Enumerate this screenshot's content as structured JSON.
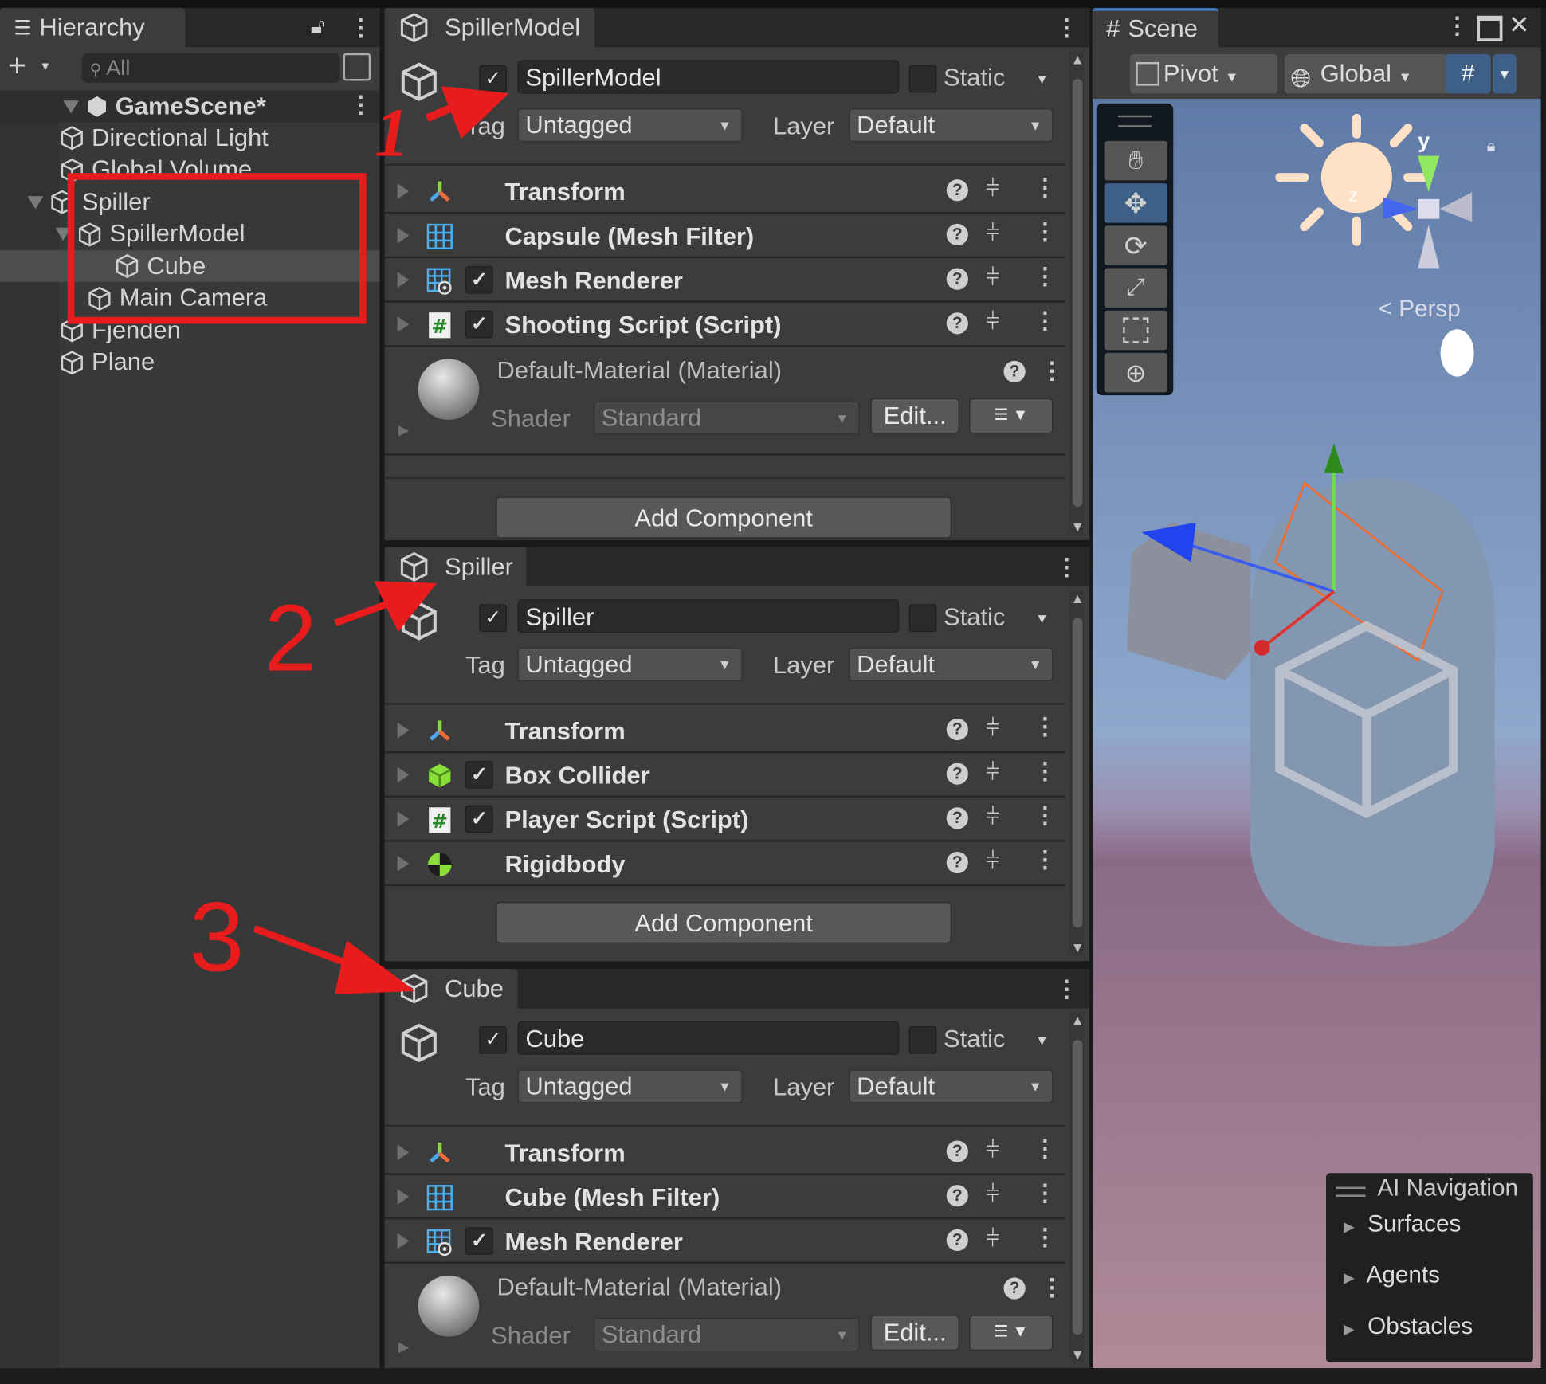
{
  "hierarchy": {
    "tab_label": "Hierarchy",
    "search_placeholder": "All",
    "scene_name": "GameScene*",
    "items": [
      {
        "label": "Directional Light",
        "depth": 1
      },
      {
        "label": "Global Volume",
        "depth": 1
      },
      {
        "label": "Spiller",
        "depth": 1,
        "expanded": true
      },
      {
        "label": "SpillerModel",
        "depth": 2,
        "expanded": true
      },
      {
        "label": "Cube",
        "depth": 3,
        "selected": true
      },
      {
        "label": "Main Camera",
        "depth": 2
      },
      {
        "label": "Fjenden",
        "depth": 1
      },
      {
        "label": "Plane",
        "depth": 1
      }
    ]
  },
  "inspectors": [
    {
      "tab_label": "SpillerModel",
      "name": "SpillerModel",
      "static_label": "Static",
      "tag_label": "Tag",
      "tag_value": "Untagged",
      "layer_label": "Layer",
      "layer_value": "Default",
      "components": [
        {
          "icon": "transform-icon",
          "label": "Transform",
          "checkbox": false
        },
        {
          "icon": "mesh-filter-icon",
          "label": "Capsule (Mesh Filter)",
          "checkbox": false
        },
        {
          "icon": "mesh-renderer-icon",
          "label": "Mesh Renderer",
          "checkbox": true
        },
        {
          "icon": "script-icon",
          "label": "Shooting Script (Script)",
          "checkbox": true
        }
      ],
      "material": {
        "label": "Default-Material (Material)",
        "shader_label": "Shader",
        "shader_value": "Standard",
        "edit_label": "Edit..."
      },
      "add_component_label": "Add Component"
    },
    {
      "tab_label": "Spiller",
      "name": "Spiller",
      "static_label": "Static",
      "tag_label": "Tag",
      "tag_value": "Untagged",
      "layer_label": "Layer",
      "layer_value": "Default",
      "components": [
        {
          "icon": "transform-icon",
          "label": "Transform",
          "checkbox": false
        },
        {
          "icon": "box-collider-icon",
          "label": "Box Collider",
          "checkbox": true
        },
        {
          "icon": "script-icon",
          "label": "Player Script (Script)",
          "checkbox": true
        },
        {
          "icon": "rigidbody-icon",
          "label": "Rigidbody",
          "checkbox": false
        }
      ],
      "add_component_label": "Add Component"
    },
    {
      "tab_label": "Cube",
      "name": "Cube",
      "static_label": "Static",
      "tag_label": "Tag",
      "tag_value": "Untagged",
      "layer_label": "Layer",
      "layer_value": "Default",
      "components": [
        {
          "icon": "transform-icon",
          "label": "Transform",
          "checkbox": false
        },
        {
          "icon": "mesh-filter-icon",
          "label": "Cube (Mesh Filter)",
          "checkbox": false
        },
        {
          "icon": "mesh-renderer-icon",
          "label": "Mesh Renderer",
          "checkbox": true
        }
      ],
      "material": {
        "label": "Default-Material (Material)",
        "shader_label": "Shader",
        "shader_value": "Standard",
        "edit_label": "Edit..."
      }
    }
  ],
  "scene": {
    "tab_label": "Scene",
    "pivot_label": "Pivot",
    "global_label": "Global",
    "persp_label": "Persp",
    "gizmo_axis_y": "y",
    "gizmo_axis_z": "z",
    "ai_nav": {
      "title": "AI Navigation",
      "items": [
        "Surfaces",
        "Agents",
        "Obstacles"
      ]
    },
    "colors": {
      "sky_top": "#5f7aa8",
      "horizon": "#9b8fb0",
      "ground": "#8a6a86",
      "selection": "#f26b2b"
    }
  },
  "annotations": {
    "labels": [
      "1",
      "2",
      "3"
    ],
    "color": "#e81c1c"
  }
}
